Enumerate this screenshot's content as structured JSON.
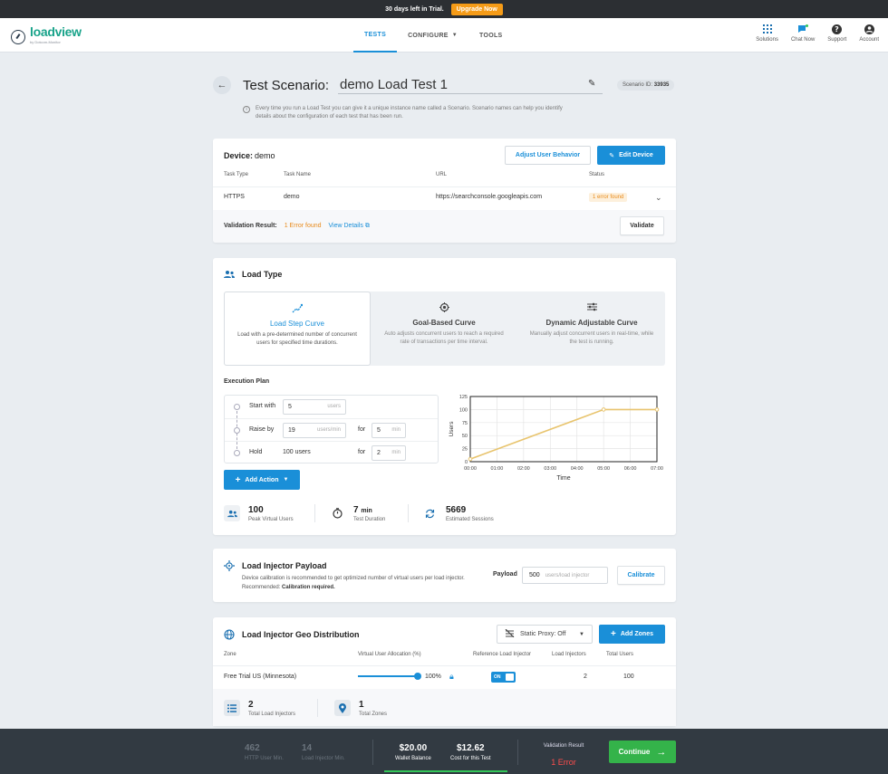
{
  "banner": {
    "text": "30 days left in Trial.",
    "upgrade": "Upgrade Now"
  },
  "header": {
    "logo": {
      "word": "loadview",
      "sub": "by Dotcom-Monitor"
    },
    "nav": [
      {
        "label": "TESTS",
        "active": true
      },
      {
        "label": "CONFIGURE",
        "dropdown": true
      },
      {
        "label": "TOOLS"
      }
    ],
    "right": [
      {
        "label": "Solutions",
        "icon": "grid-icon"
      },
      {
        "label": "Chat Now",
        "icon": "chat-icon"
      },
      {
        "label": "Support",
        "icon": "help-icon"
      },
      {
        "label": "Account",
        "icon": "user-icon"
      }
    ]
  },
  "scenario": {
    "label": "Test Scenario:",
    "name": "demo Load Test 1",
    "id_label": "Scenario ID:",
    "id": "33935",
    "info": "Every time you run a Load Test you can give it a unique instance name called a Scenario. Scenario names can help you identify details about the configuration of each test that has been run."
  },
  "device": {
    "label": "Device:",
    "name": "demo",
    "adjust_btn": "Adjust User Behavior",
    "edit_btn": "Edit Device",
    "headers": [
      "Task Type",
      "Task Name",
      "URL",
      "Status"
    ],
    "row": {
      "type": "HTTPS",
      "name": "demo",
      "url": "https://searchconsole.googleapis.com",
      "status": "1 error found"
    },
    "validation_label": "Validation Result:",
    "validation_error": "1 Error found",
    "view_details": "View Details",
    "validate_btn": "Validate"
  },
  "load_type": {
    "title": "Load Type",
    "curves": [
      {
        "title": "Load Step Curve",
        "desc": "Load with a pre-determined number of concurrent users for specified time durations.",
        "active": true
      },
      {
        "title": "Goal-Based Curve",
        "desc": "Auto adjusts concurrent users to reach a required rate of transactions per time interval."
      },
      {
        "title": "Dynamic Adjustable Curve",
        "desc": "Manually adjust concurrent users in real-time, while the test is running."
      }
    ],
    "plan_title": "Execution Plan",
    "plan": {
      "start_label": "Start with",
      "start_value": "5",
      "start_unit": "users",
      "raise_label": "Raise by",
      "raise_value": "19",
      "raise_unit": "users/min",
      "raise_for": "for",
      "raise_for_value": "5",
      "raise_for_unit": "min",
      "hold_label": "Hold",
      "hold_value": "100 users",
      "hold_for": "for",
      "hold_for_value": "2",
      "hold_for_unit": "min"
    },
    "add_action": "Add Action",
    "stats": [
      {
        "value": "100",
        "unit": "",
        "label": "Peak Virtual Users"
      },
      {
        "value": "7",
        "unit": "min",
        "label": "Test Duration"
      },
      {
        "value": "5669",
        "unit": "",
        "label": "Estimated Sessions"
      }
    ]
  },
  "chart_data": {
    "type": "line",
    "xlabel": "Time",
    "ylabel": "Users",
    "x_ticks": [
      "00:00",
      "01:00",
      "02:00",
      "03:00",
      "04:00",
      "05:00",
      "06:00",
      "07:00"
    ],
    "y_ticks": [
      0,
      25,
      50,
      75,
      100,
      125
    ],
    "xlim": [
      0,
      7
    ],
    "ylim": [
      0,
      125
    ],
    "grid": true,
    "series": [
      {
        "x": [
          0,
          5,
          7
        ],
        "y": [
          5,
          100,
          100
        ],
        "color": "#e8c46e"
      }
    ]
  },
  "payload": {
    "title": "Load Injector Payload",
    "desc": "Device calibration is recommended to get optimized number of virtual users per load injector. Recommended:",
    "desc_bold": "Calibration required.",
    "label": "Payload",
    "value": "500",
    "unit": "users/load injector",
    "calibrate_btn": "Calibrate"
  },
  "geo": {
    "title": "Load Injector Geo Distribution",
    "proxy": "Static Proxy: Off",
    "add_zones": "Add Zones",
    "headers": [
      "Zone",
      "Virtual User Allocation (%)",
      "Reference Load Injector",
      "Load Injectors",
      "Total Users"
    ],
    "row": {
      "zone": "Free Trial US (Minnesota)",
      "alloc": "100%",
      "alloc_fraction": 1.0,
      "ref": "ON",
      "injectors": "2",
      "users": "100"
    },
    "stats": [
      {
        "value": "2",
        "label": "Total Load Injectors"
      },
      {
        "value": "1",
        "label": "Total Zones"
      }
    ]
  },
  "footer": {
    "http_min": "462",
    "http_min_label": "HTTP User Min.",
    "inj_min": "14",
    "inj_min_label": "Load Injector Min.",
    "wallet": "$20.00",
    "wallet_label": "Wallet Balance",
    "cost": "$12.62",
    "cost_label": "Cost for this Test",
    "val_label": "Validation Result",
    "val_value": "1 Error",
    "continue": "Continue"
  },
  "colors": {
    "accent": "#1a8fd8",
    "warning": "#e88a1a",
    "success": "#34b34a",
    "error": "#ff4d4d"
  }
}
